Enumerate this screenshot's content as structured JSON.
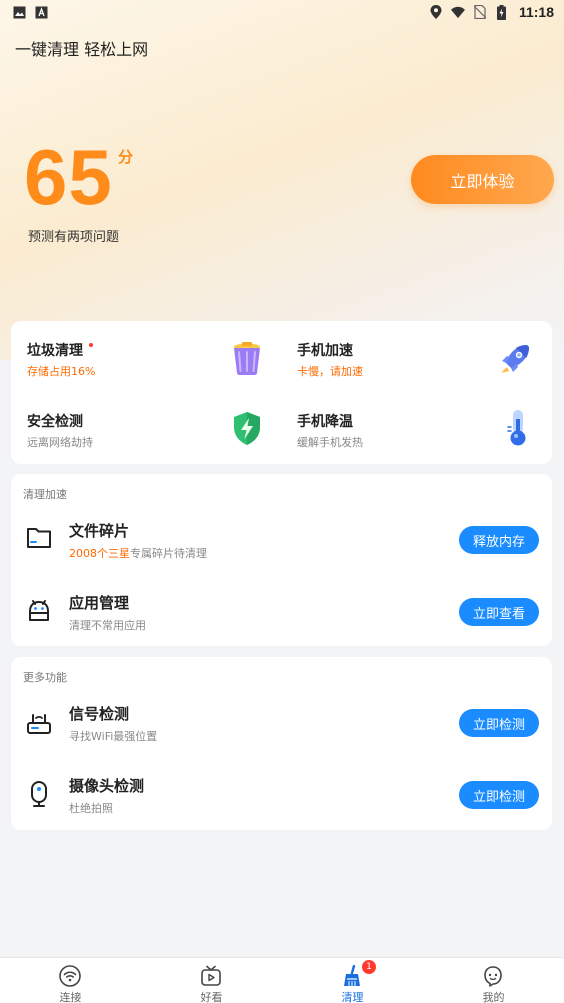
{
  "status_bar": {
    "time": "11:18",
    "left_icons": [
      "image-icon",
      "app-a-icon"
    ],
    "right_icons": [
      "location-icon",
      "wifi-icon",
      "no-sim-icon",
      "battery-icon"
    ]
  },
  "header": {
    "title": "一键清理 轻松上网",
    "score": "65",
    "score_unit": "分",
    "score_desc": "预测有两项问题",
    "try_button": "立即体验"
  },
  "grid": {
    "items": [
      {
        "title": "垃圾清理",
        "subtitle": "存储占用16%",
        "icon": "trash-bin-icon",
        "has_dot": true
      },
      {
        "title": "手机加速",
        "subtitle": "卡慢，请加速",
        "icon": "rocket-icon"
      },
      {
        "title": "安全检测",
        "subtitle": "远离网络劫持",
        "icon": "shield-icon"
      },
      {
        "title": "手机降温",
        "subtitle": "缓解手机发热",
        "icon": "thermometer-icon"
      }
    ]
  },
  "clean_section": {
    "label": "清理加速",
    "rows": [
      {
        "title": "文件碎片",
        "sub_highlight": "2008个三星",
        "sub_rest": "专属碎片待清理",
        "button": "释放内存",
        "icon": "folder-icon"
      },
      {
        "title": "应用管理",
        "sub": "清理不常用应用",
        "button": "立即查看",
        "icon": "android-icon"
      }
    ]
  },
  "more_section": {
    "label": "更多功能",
    "rows": [
      {
        "title": "信号检测",
        "sub": "寻找WiFi最强位置",
        "button": "立即检测",
        "icon": "router-icon"
      },
      {
        "title": "摄像头检测",
        "sub": "杜绝拍照",
        "button": "立即检测",
        "icon": "camera-icon"
      }
    ]
  },
  "bottom_nav": {
    "items": [
      {
        "label": "连接",
        "icon": "wifi-nav-icon"
      },
      {
        "label": "好看",
        "icon": "tv-icon"
      },
      {
        "label": "清理",
        "icon": "broom-icon",
        "badge": "1",
        "active": true
      },
      {
        "label": "我的",
        "icon": "face-icon"
      }
    ]
  },
  "colors": {
    "accent_orange": "#ff8c1a",
    "accent_blue": "#1a8cff",
    "active_nav": "#1a6fe0"
  }
}
